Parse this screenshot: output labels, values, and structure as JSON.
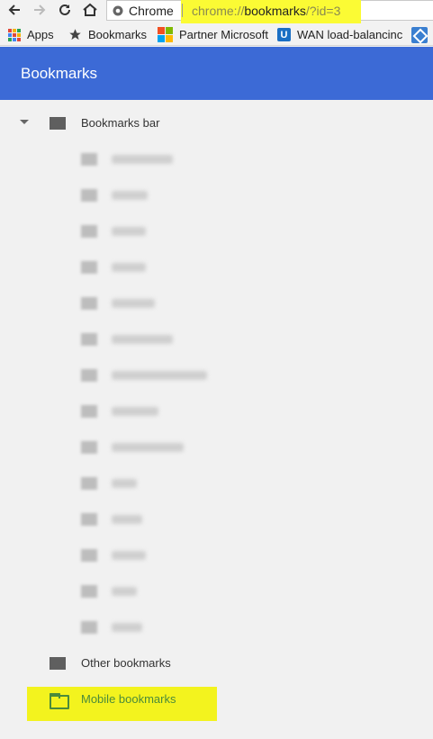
{
  "browser": {
    "chip_label": "Chrome",
    "url_scheme": "chrome://",
    "url_host": "bookmarks",
    "url_rest": "/?id=3"
  },
  "bookmarks_bar": [
    {
      "label": "Apps",
      "icon": "apps-grid-icon"
    },
    {
      "label": "Bookmarks",
      "icon": "star-icon"
    },
    {
      "label": "Partner Microsoft",
      "icon": "microsoft-logo-icon"
    },
    {
      "label": "WAN load-balancinc",
      "icon": "ubiquiti-logo-icon"
    }
  ],
  "colors": {
    "header": "#3c6ad6",
    "highlight": "#f3f31e",
    "mobile_folder": "#4b8b3b"
  },
  "app": {
    "title": "Bookmarks"
  },
  "tree": {
    "root": {
      "label": "Bookmarks bar",
      "expanded": true
    },
    "children_blurred_count": 14,
    "other": {
      "label": "Other bookmarks"
    },
    "mobile": {
      "label": "Mobile bookmarks",
      "selected": true
    }
  }
}
